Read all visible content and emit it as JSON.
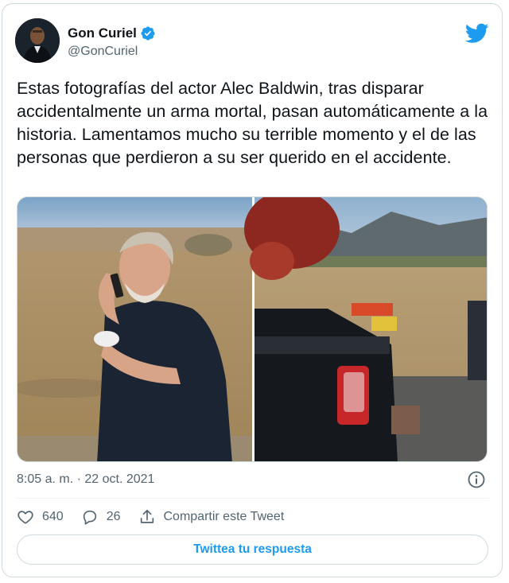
{
  "author": {
    "name": "Gon Curiel",
    "handle": "@GonCuriel",
    "verified": true
  },
  "tweet": {
    "text": "Estas fotografías del actor Alec Baldwin, tras disparar accidentalmente un arma mortal, pasan automáticamente a la historia. Lamentamos mucho su terrible momento y el de las personas que perdieron a su ser querido en el accidente.",
    "timestamp": "8:05 a. m. · 22 oct. 2021"
  },
  "media": [
    {
      "subject": "man-on-phone-photo"
    },
    {
      "subject": "vehicle-in-desert-photo"
    }
  ],
  "actions": {
    "like_count": "640",
    "reply_count": "26",
    "share_label": "Compartir este Tweet"
  },
  "reply_button_label": "Twittea tu respuesta",
  "colors": {
    "accent": "#1d9bf0",
    "text": "#0f1419",
    "secondary_text": "#536471",
    "border": "#cfd9de"
  }
}
